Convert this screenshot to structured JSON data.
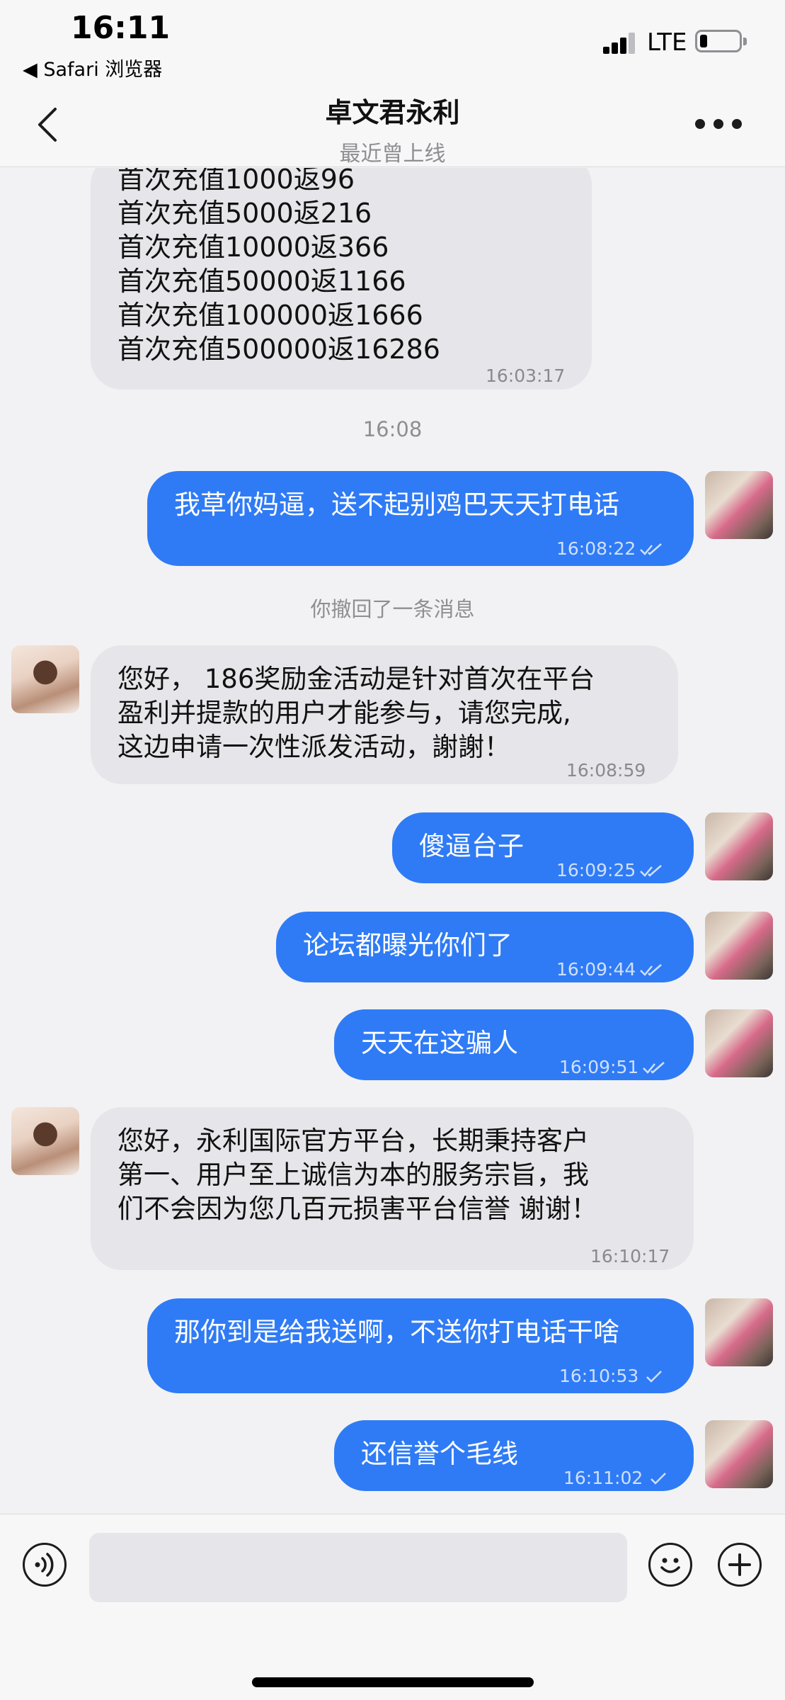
{
  "status_bar": {
    "time": "16:11",
    "back_app": "Safari 浏览器",
    "network": "LTE"
  },
  "header": {
    "title": "卓文君永利",
    "subtitle": "最近曾上线",
    "back_icon": "chevron-left-icon",
    "more_icon": "ellipsis-icon"
  },
  "messages": [
    {
      "direction": "in",
      "lines": [
        "首次充值1000返96",
        "首次充值5000返216",
        "首次充值10000返366",
        "首次充值50000返1166",
        "首次充值100000返1666",
        "首次充值500000返16286"
      ],
      "time": "16:03:17"
    },
    {
      "type": "time_divider",
      "text": "16:08"
    },
    {
      "direction": "out",
      "text": "我草你妈逼，送不起别鸡巴天天打电话",
      "time": "16:08:22",
      "status": "read"
    },
    {
      "type": "system",
      "text": "你撤回了一条消息"
    },
    {
      "direction": "in",
      "lines": [
        "您好， 186奖励金活动是针对首次在平台",
        "盈利并提款的用户才能参与，请您完成,",
        "这边申请一次性派发活动，謝謝！"
      ],
      "time": "16:08:59"
    },
    {
      "direction": "out",
      "text": "傻逼台子",
      "time": "16:09:25",
      "status": "read"
    },
    {
      "direction": "out",
      "text": "论坛都曝光你们了",
      "time": "16:09:44",
      "status": "read"
    },
    {
      "direction": "out",
      "text": "天天在这骗人",
      "time": "16:09:51",
      "status": "read"
    },
    {
      "direction": "in",
      "lines": [
        "您好，永利国际官方平台，长期秉持客户",
        "第一、用户至上诚信为本的服务宗旨，我",
        "们不会因为您几百元损害平台信誉  谢谢！"
      ],
      "time": "16:10:17"
    },
    {
      "direction": "out",
      "text": "那你到是给我送啊，不送你打电话干啥",
      "time": "16:10:53",
      "status": "sent"
    },
    {
      "direction": "out",
      "text": "还信誉个毛线",
      "time": "16:11:02",
      "status": "sent"
    }
  ],
  "input_bar": {
    "placeholder": "",
    "voice_icon": "voice-icon",
    "emoji_icon": "emoji-icon",
    "plus_icon": "plus-icon"
  },
  "colors": {
    "outgoing_bubble": "#2f7bf5",
    "incoming_bubble": "#e6e6ea",
    "background": "#f2f2f4"
  }
}
